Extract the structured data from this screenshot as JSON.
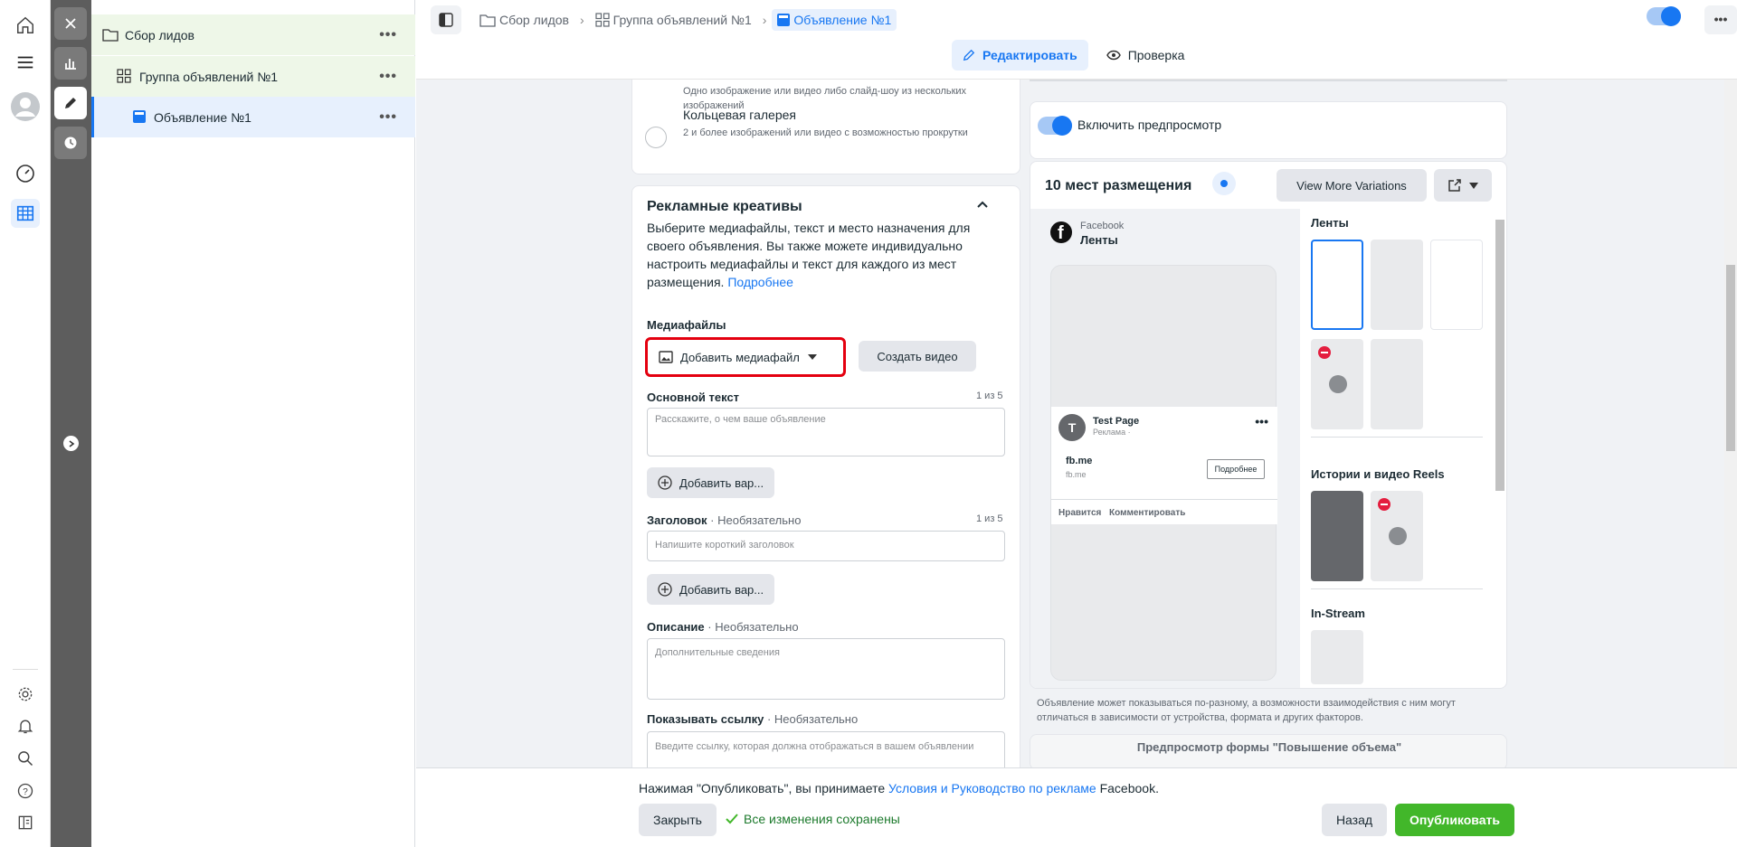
{
  "breadcrumb": {
    "campaign": "Сбор лидов",
    "adset": "Группа объявлений №1",
    "ad": "Объявление №1"
  },
  "tabs": {
    "edit": "Редактировать",
    "review": "Проверка"
  },
  "tree": {
    "campaign": "Сбор лидов",
    "adset": "Группа объявлений №1",
    "ad": "Объявление №1",
    "more": "•••"
  },
  "format": {
    "single_desc": "Одно изображение или видео либо слайд-шоу из нескольких изображений",
    "carousel_title": "Кольцевая галерея",
    "carousel_desc": "2 и более изображений или видео с возможностью прокрутки"
  },
  "creative": {
    "title": "Рекламные креативы",
    "description": "Выберите медиафайлы, текст и место назначения для своего объявления. Вы также можете индивидуально настроить медиафайлы и текст для каждого из мест размещения.",
    "learn_more": "Подробнее",
    "media_label": "Медиафайлы",
    "add_media": "Добавить медиафайл",
    "create_video": "Создать видео",
    "primary_text_label": "Основной текст",
    "primary_text_count": "1 из 5",
    "primary_text_placeholder": "Расскажите, о чем ваше объявление",
    "add_variant": "Добавить вар...",
    "headline_label": "Заголовок",
    "optional": "· Необязательно",
    "headline_count": "1 из 5",
    "headline_placeholder": "Напишите короткий заголовок",
    "description_label": "Описание",
    "description_placeholder": "Дополнительные сведения",
    "display_link_label": "Показывать ссылку",
    "display_link_placeholder": "Введите ссылку, которая должна отображаться в вашем объявлении"
  },
  "preview": {
    "toggle_label": "Включить предпросмотр",
    "placements_title": "10 мест размещения",
    "view_more": "View More Variations",
    "platform": "Facebook",
    "placement": "Ленты",
    "page_name": "Test Page",
    "sponsored": "Реклама · ",
    "link_domain": "fb.me",
    "link_sub": "fb.me",
    "cta": "Подробнее",
    "like": "Нравится",
    "comment": "Комментировать",
    "section_feeds": "Ленты",
    "section_stories": "Истории и видео Reels",
    "section_instream": "In-Stream",
    "footer_note": "Объявление может показываться по-разному, а возможности взаимодействия с ним могут отличаться в зависимости от устройства, формата и других факторов.",
    "form_preview_title": "Предпросмотр формы \"Повышение объема\""
  },
  "footer": {
    "terms_prefix": "Нажимая \"Опубликовать\", вы принимаете ",
    "terms_link": "Условия и Руководство по рекламе",
    "terms_suffix": " Facebook.",
    "close": "Закрыть",
    "saved": "Все изменения сохранены",
    "back": "Назад",
    "publish": "Опубликовать"
  },
  "colors": {
    "accent": "#1877f2",
    "publish": "#42b72a",
    "highlight": "#e4000f"
  }
}
